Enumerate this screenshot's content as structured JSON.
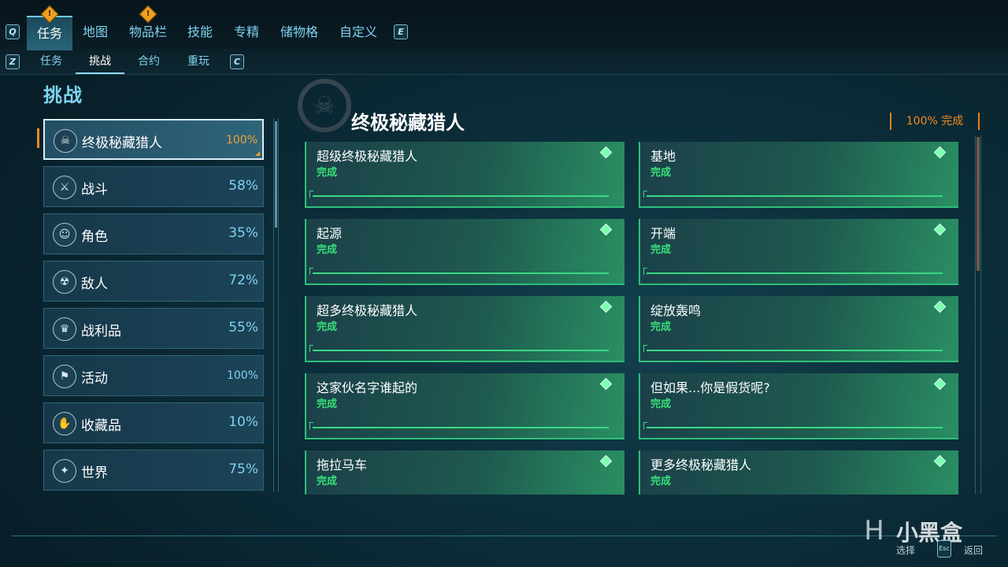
{
  "top_nav": {
    "prev_key": "Q",
    "next_key": "E",
    "tabs": [
      {
        "label": "任务",
        "alert": "!"
      },
      {
        "label": "地图"
      },
      {
        "label": "物品栏",
        "alert": "!"
      },
      {
        "label": "技能"
      },
      {
        "label": "专精"
      },
      {
        "label": "储物格"
      },
      {
        "label": "自定义"
      }
    ]
  },
  "sub_nav": {
    "prev_key": "Z",
    "next_key": "C",
    "tabs": [
      "任务",
      "挑战",
      "合约",
      "重玩"
    ]
  },
  "section_title": "挑战",
  "categories": [
    {
      "name": "终极秘藏猎人",
      "pct": "100%",
      "icon": "vault-hunter-icon",
      "glyph": "☠"
    },
    {
      "name": "战斗",
      "pct": "58%",
      "icon": "gun-icon",
      "glyph": "⚔"
    },
    {
      "name": "角色",
      "pct": "35%",
      "icon": "character-icon",
      "glyph": "☺"
    },
    {
      "name": "敌人",
      "pct": "72%",
      "icon": "enemy-icon",
      "glyph": "☢"
    },
    {
      "name": "战利品",
      "pct": "55%",
      "icon": "loot-icon",
      "glyph": "♛"
    },
    {
      "name": "活动",
      "pct": "100%",
      "icon": "activity-icon",
      "glyph": "⚑"
    },
    {
      "name": "收藏品",
      "pct": "10%",
      "icon": "collectible-icon",
      "glyph": "✋"
    },
    {
      "name": "世界",
      "pct": "75%",
      "icon": "world-icon",
      "glyph": "✦"
    }
  ],
  "detail": {
    "title": "终极秘藏猎人",
    "progress": "100% 完成",
    "emblem_glyph": "☠"
  },
  "challenges": [
    {
      "title": "超级终极秘藏猎人",
      "status": "完成"
    },
    {
      "title": "基地",
      "status": "完成"
    },
    {
      "title": "起源",
      "status": "完成"
    },
    {
      "title": "开端",
      "status": "完成"
    },
    {
      "title": "超多终极秘藏猎人",
      "status": "完成"
    },
    {
      "title": "绽放轰鸣",
      "status": "完成"
    },
    {
      "title": "这家伙名字谁起的",
      "status": "完成"
    },
    {
      "title": "但如果...你是假货呢?",
      "status": "完成"
    },
    {
      "title": "拖拉马车",
      "status": "完成"
    },
    {
      "title": "更多终极秘藏猎人",
      "status": "完成"
    }
  ],
  "footer": {
    "brand": "小黑盒",
    "select_label": "选择",
    "back_label": "返回",
    "back_key": "Esc",
    "logo_glyph": "H"
  },
  "colors": {
    "accent_cyan": "#7fd3f0",
    "complete_green": "#38e07a",
    "progress_orange": "#f08a20"
  }
}
